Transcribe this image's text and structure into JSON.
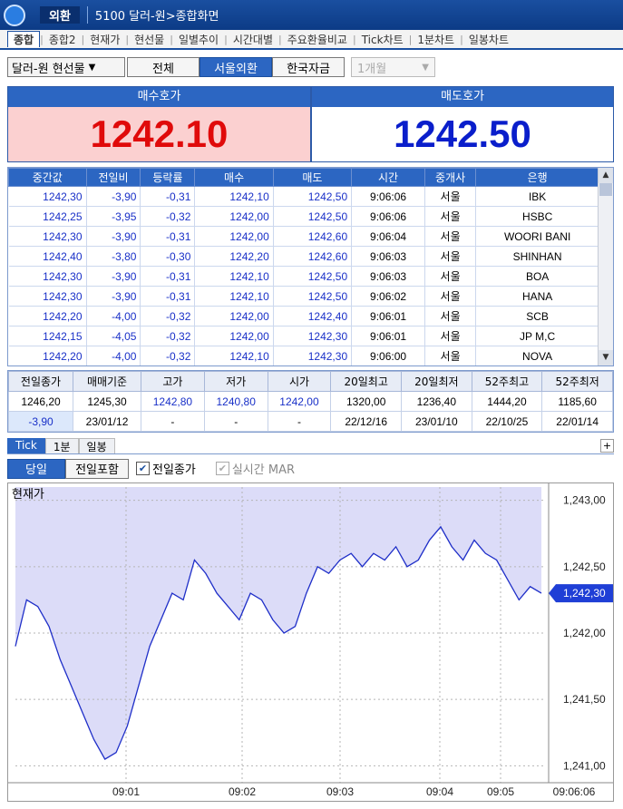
{
  "titlebar": {
    "category": "외환",
    "screen": "5100 달러-원>종합화면"
  },
  "tabs": [
    "종합",
    "종합2",
    "현재가",
    "현선물",
    "일별추이",
    "시간대별",
    "주요환율비교",
    "Tick차트",
    "1분차트",
    "일봉차트"
  ],
  "controls": {
    "product": "달러-원 현선물",
    "segments": [
      "전체",
      "서울외환",
      "한국자금"
    ],
    "period": "1개월"
  },
  "quotes": {
    "bid_label": "매수호가",
    "bid_value": "1242.10",
    "ask_label": "매도호가",
    "ask_value": "1242.50"
  },
  "grid": {
    "columns": [
      "중간값",
      "전일비",
      "등락률",
      "매수",
      "매도",
      "시간",
      "중개사",
      "은행"
    ],
    "rows": [
      [
        "1242,30",
        "-3,90",
        "-0,31",
        "1242,10",
        "1242,50",
        "9:06:06",
        "서울",
        "IBK"
      ],
      [
        "1242,25",
        "-3,95",
        "-0,32",
        "1242,00",
        "1242,50",
        "9:06:06",
        "서울",
        "HSBC"
      ],
      [
        "1242,30",
        "-3,90",
        "-0,31",
        "1242,00",
        "1242,60",
        "9:06:04",
        "서울",
        "WOORI BANI"
      ],
      [
        "1242,40",
        "-3,80",
        "-0,30",
        "1242,20",
        "1242,60",
        "9:06:03",
        "서울",
        "SHINHAN"
      ],
      [
        "1242,30",
        "-3,90",
        "-0,31",
        "1242,10",
        "1242,50",
        "9:06:03",
        "서울",
        "BOA"
      ],
      [
        "1242,30",
        "-3,90",
        "-0,31",
        "1242,10",
        "1242,50",
        "9:06:02",
        "서울",
        "HANA"
      ],
      [
        "1242,20",
        "-4,00",
        "-0,32",
        "1242,00",
        "1242,40",
        "9:06:01",
        "서울",
        "SCB"
      ],
      [
        "1242,15",
        "-4,05",
        "-0,32",
        "1242,00",
        "1242,30",
        "9:06:01",
        "서울",
        "JP M,C"
      ],
      [
        "1242,20",
        "-4,00",
        "-0,32",
        "1242,10",
        "1242,30",
        "9:06:00",
        "서울",
        "NOVA"
      ]
    ]
  },
  "summary": {
    "headers": [
      "전일종가",
      "매매기준",
      "고가",
      "저가",
      "시가",
      "20일최고",
      "20일최저",
      "52주최고",
      "52주최저"
    ],
    "row1": [
      "1246,20",
      "1245,30",
      "1242,80",
      "1240,80",
      "1242,00",
      "1320,00",
      "1236,40",
      "1444,20",
      "1185,60"
    ],
    "row2": [
      "-3,90",
      "23/01/12",
      "-",
      "-",
      "-",
      "22/12/16",
      "23/01/10",
      "22/10/25",
      "22/01/14"
    ]
  },
  "chart_tabs": [
    "Tick",
    "1분",
    "일봉"
  ],
  "chart_options": {
    "day_buttons": [
      "당일",
      "전일포함"
    ],
    "prev_close_check": "전일종가",
    "realtime_check": "실시간 MAR"
  },
  "chart_data": {
    "type": "area",
    "title": "현재가",
    "ylim": [
      1240.9,
      1243.1
    ],
    "y_ticks": [
      1243.0,
      1242.5,
      1242.0,
      1241.5,
      1241.0
    ],
    "y_tick_labels": [
      "1,243,00",
      "1,242,50",
      "1,242,00",
      "1,241,50",
      "1,241,00"
    ],
    "x_ticks": [
      "09:01",
      "09:02",
      "09:03",
      "09:04",
      "09:05",
      "09:06:06"
    ],
    "current_label": "1,242,30",
    "current_value": 1242.3,
    "colors": {
      "fill": "#dcdcf8",
      "line": "#1e2ec8",
      "marker": "#1f3fd6"
    },
    "series": [
      {
        "values": [
          1241.9,
          1242.25,
          1242.2,
          1242.05,
          1241.8,
          1241.6,
          1241.4,
          1241.2,
          1241.05,
          1241.1,
          1241.3,
          1241.6,
          1241.9,
          1242.1,
          1242.3,
          1242.25,
          1242.55,
          1242.45,
          1242.3,
          1242.2,
          1242.1,
          1242.3,
          1242.25,
          1242.1,
          1242.0,
          1242.05,
          1242.3,
          1242.5,
          1242.45,
          1242.55,
          1242.6,
          1242.5,
          1242.6,
          1242.55,
          1242.65,
          1242.5,
          1242.55,
          1242.7,
          1242.8,
          1242.65,
          1242.55,
          1242.7,
          1242.6,
          1242.55,
          1242.4,
          1242.25,
          1242.35,
          1242.3
        ]
      }
    ]
  }
}
